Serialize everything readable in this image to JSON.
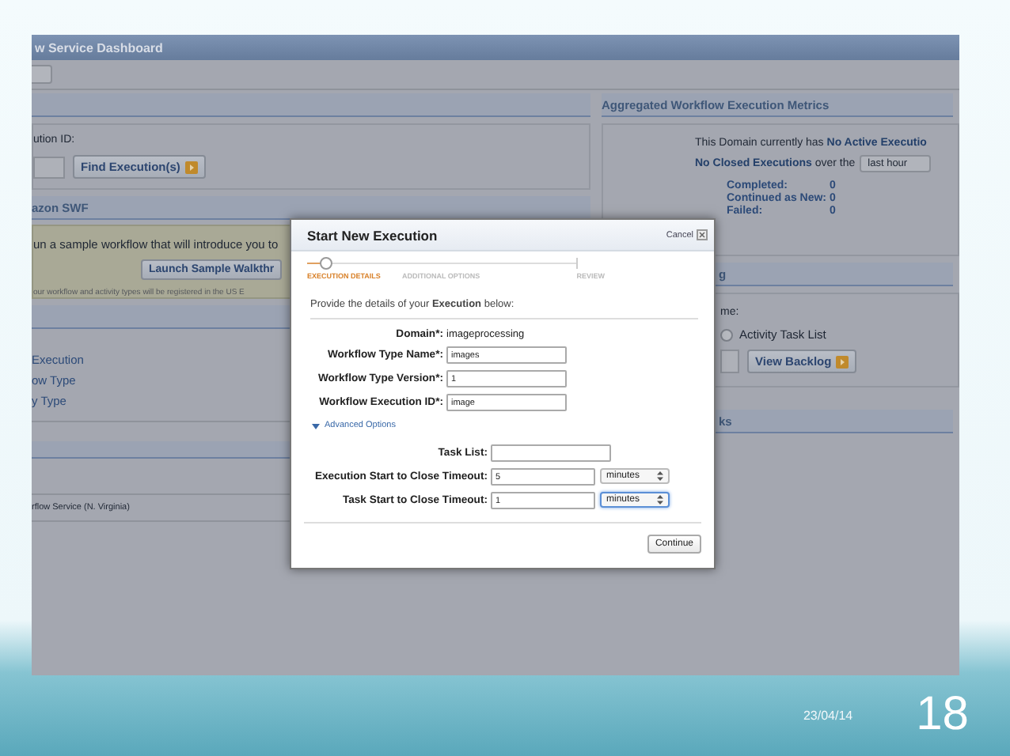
{
  "slide": {
    "date": "23/04/14",
    "page_number": "18"
  },
  "dashboard": {
    "title": "w Service Dashboard",
    "left": {
      "search_panel": {
        "label": "ution ID:",
        "button": "Find Execution(s)"
      },
      "getting_started": {
        "title": "azon SWF",
        "intro": "un a sample workflow that will introduce you to",
        "button": "Launch Sample Walkthr",
        "note": "our workflow and activity types will be registered in the US E"
      },
      "quick_links": [
        "Execution",
        "ow Type",
        "y Type"
      ],
      "region_row": "rflow Service (N. Virginia)"
    },
    "right": {
      "metrics": {
        "title": "Aggregated Workflow Execution Metrics",
        "active_line": "This Domain currently has **No Active Executio**",
        "closed_line": "**No Closed Executions** over the",
        "period": "last hour",
        "stats": [
          {
            "label": "Completed:",
            "value": "0"
          },
          {
            "label": "Continued as New:",
            "value": "0"
          },
          {
            "label": "Failed:",
            "value": "0"
          }
        ]
      },
      "backlog": {
        "title": "g",
        "field_label": "me:",
        "radio_label": "Activity Task List",
        "radio_selected": false,
        "button": "View Backlog"
      },
      "links_section": {
        "title": "ks"
      }
    }
  },
  "modal": {
    "title": "Start New Execution",
    "cancel": "Cancel",
    "steps": [
      {
        "label": "EXECUTION DETAILS",
        "selected": true
      },
      {
        "label": "ADDITIONAL OPTIONS",
        "selected": false
      },
      {
        "label": "REVIEW",
        "selected": false
      }
    ],
    "instructions": "Provide the details of your **Execution** below:",
    "fields": [
      {
        "kind": "text",
        "label": "Domain*:",
        "value": "imageprocessing"
      },
      {
        "kind": "input",
        "label": "Workflow Type Name*:",
        "value": "images"
      },
      {
        "kind": "input",
        "label": "Workflow Type Version*:",
        "value": "1"
      },
      {
        "kind": "input",
        "label": "Workflow Execution ID*:",
        "value": "image"
      }
    ],
    "advanced": {
      "label": "Advanced Options",
      "expanded": true
    },
    "advanced_fields": [
      {
        "kind": "input",
        "label": "Task List:"
      },
      {
        "kind": "input_select",
        "label": "Execution Start to Close Timeout:",
        "value": "5",
        "unit": "minutes",
        "focused": false
      },
      {
        "kind": "input_select",
        "label": "Task Start to Close Timeout:",
        "value": "1",
        "unit": "minutes",
        "focused": true
      }
    ],
    "continue": "Continue"
  }
}
